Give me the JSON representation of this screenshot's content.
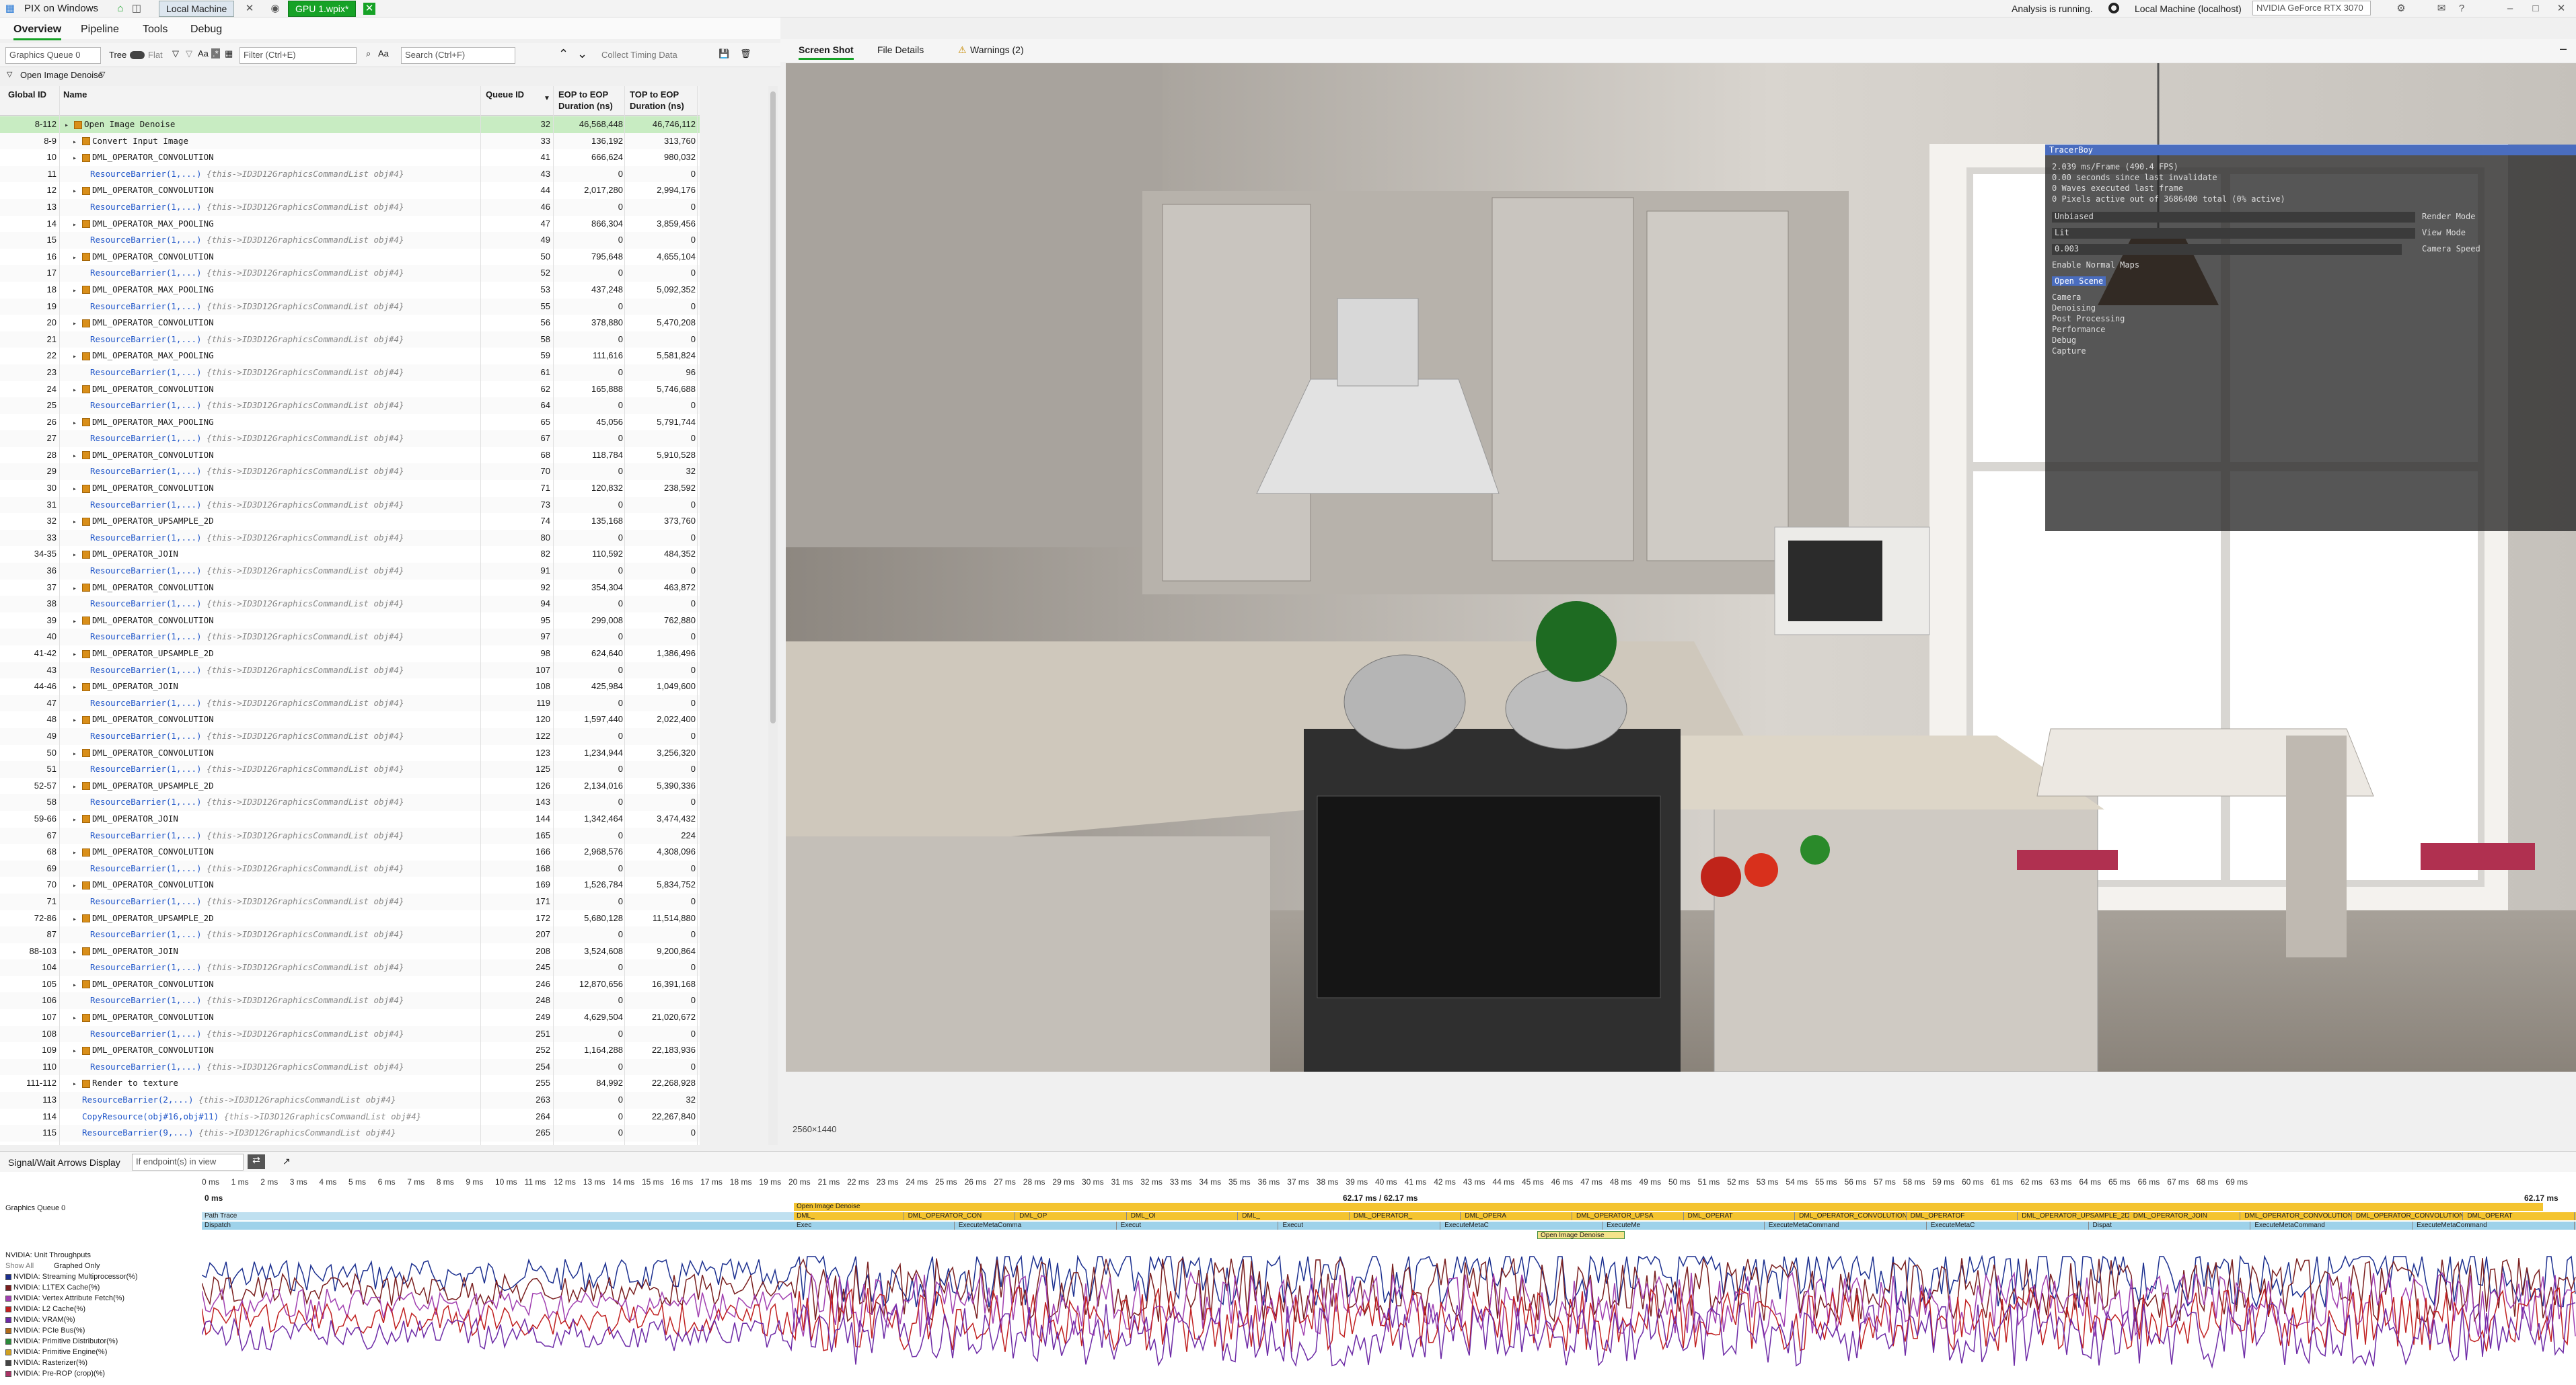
{
  "titlebar": {
    "app_name": "PIX on Windows",
    "tabs": [
      "Local Machine",
      "GPU 1.wpix*"
    ],
    "analysis_status": "Analysis is running.",
    "machine": "Local Machine (localhost)",
    "gpu": "NVIDIA GeForce RTX 3070"
  },
  "menu": {
    "items": [
      "Overview",
      "Pipeline",
      "Tools",
      "Debug"
    ],
    "active": "Overview"
  },
  "left_toolbar": {
    "queue": "Graphics Queue 0",
    "tree_label": "Tree",
    "flat_label": "Flat",
    "filter_placeholder": "Filter (Ctrl+E)",
    "search_placeholder": "Search (Ctrl+F)",
    "collect_timing": "Collect Timing Data",
    "breadcrumb": "Open Image Denoise"
  },
  "table": {
    "headers": [
      "Global ID",
      "Name",
      "Queue ID",
      "EOP to EOP\nDuration (ns)",
      "TOP to EOP\nDuration (ns)"
    ],
    "rows": [
      {
        "gid": "8-112",
        "name": "Open Image Denoise",
        "q": "32",
        "eop": "46,568,448",
        "top": "46,746,112",
        "kind": "group",
        "sel": true,
        "indent": 0
      },
      {
        "gid": "8-9",
        "name": "Convert Input Image",
        "q": "33",
        "eop": "136,192",
        "top": "313,760",
        "kind": "group",
        "indent": 1
      },
      {
        "gid": "10",
        "name": "DML_OPERATOR_CONVOLUTION",
        "q": "41",
        "eop": "666,624",
        "top": "980,032",
        "kind": "group",
        "indent": 1
      },
      {
        "gid": "11",
        "name": "ResourceBarrier(1,...)",
        "q": "43",
        "eop": "0",
        "top": "0",
        "kind": "call",
        "indent": 2
      },
      {
        "gid": "12",
        "name": "DML_OPERATOR_CONVOLUTION",
        "q": "44",
        "eop": "2,017,280",
        "top": "2,994,176",
        "kind": "group",
        "indent": 1
      },
      {
        "gid": "13",
        "name": "ResourceBarrier(1,...)",
        "q": "46",
        "eop": "0",
        "top": "0",
        "kind": "call",
        "indent": 2
      },
      {
        "gid": "14",
        "name": "DML_OPERATOR_MAX_POOLING",
        "q": "47",
        "eop": "866,304",
        "top": "3,859,456",
        "kind": "group",
        "indent": 1
      },
      {
        "gid": "15",
        "name": "ResourceBarrier(1,...)",
        "q": "49",
        "eop": "0",
        "top": "0",
        "kind": "call",
        "indent": 2
      },
      {
        "gid": "16",
        "name": "DML_OPERATOR_CONVOLUTION",
        "q": "50",
        "eop": "795,648",
        "top": "4,655,104",
        "kind": "group",
        "indent": 1
      },
      {
        "gid": "17",
        "name": "ResourceBarrier(1,...)",
        "q": "52",
        "eop": "0",
        "top": "0",
        "kind": "call",
        "indent": 2
      },
      {
        "gid": "18",
        "name": "DML_OPERATOR_MAX_POOLING",
        "q": "53",
        "eop": "437,248",
        "top": "5,092,352",
        "kind": "group",
        "indent": 1
      },
      {
        "gid": "19",
        "name": "ResourceBarrier(1,...)",
        "q": "55",
        "eop": "0",
        "top": "0",
        "kind": "call",
        "indent": 2
      },
      {
        "gid": "20",
        "name": "DML_OPERATOR_CONVOLUTION",
        "q": "56",
        "eop": "378,880",
        "top": "5,470,208",
        "kind": "group",
        "indent": 1
      },
      {
        "gid": "21",
        "name": "ResourceBarrier(1,...)",
        "q": "58",
        "eop": "0",
        "top": "0",
        "kind": "call",
        "indent": 2
      },
      {
        "gid": "22",
        "name": "DML_OPERATOR_MAX_POOLING",
        "q": "59",
        "eop": "111,616",
        "top": "5,581,824",
        "kind": "group",
        "indent": 1
      },
      {
        "gid": "23",
        "name": "ResourceBarrier(1,...)",
        "q": "61",
        "eop": "0",
        "top": "96",
        "kind": "call",
        "indent": 2
      },
      {
        "gid": "24",
        "name": "DML_OPERATOR_CONVOLUTION",
        "q": "62",
        "eop": "165,888",
        "top": "5,746,688",
        "kind": "group",
        "indent": 1
      },
      {
        "gid": "25",
        "name": "ResourceBarrier(1,...)",
        "q": "64",
        "eop": "0",
        "top": "0",
        "kind": "call",
        "indent": 2
      },
      {
        "gid": "26",
        "name": "DML_OPERATOR_MAX_POOLING",
        "q": "65",
        "eop": "45,056",
        "top": "5,791,744",
        "kind": "group",
        "indent": 1
      },
      {
        "gid": "27",
        "name": "ResourceBarrier(1,...)",
        "q": "67",
        "eop": "0",
        "top": "0",
        "kind": "call",
        "indent": 2
      },
      {
        "gid": "28",
        "name": "DML_OPERATOR_CONVOLUTION",
        "q": "68",
        "eop": "118,784",
        "top": "5,910,528",
        "kind": "group",
        "indent": 1
      },
      {
        "gid": "29",
        "name": "ResourceBarrier(1,...)",
        "q": "70",
        "eop": "0",
        "top": "32",
        "kind": "call",
        "indent": 2
      },
      {
        "gid": "30",
        "name": "DML_OPERATOR_CONVOLUTION",
        "q": "71",
        "eop": "120,832",
        "top": "238,592",
        "kind": "group",
        "indent": 1
      },
      {
        "gid": "31",
        "name": "ResourceBarrier(1,...)",
        "q": "73",
        "eop": "0",
        "top": "0",
        "kind": "call",
        "indent": 2
      },
      {
        "gid": "32",
        "name": "DML_OPERATOR_UPSAMPLE_2D",
        "q": "74",
        "eop": "135,168",
        "top": "373,760",
        "kind": "group",
        "indent": 1
      },
      {
        "gid": "33",
        "name": "ResourceBarrier(1,...)",
        "q": "80",
        "eop": "0",
        "top": "0",
        "kind": "call",
        "indent": 2
      },
      {
        "gid": "34-35",
        "name": "DML_OPERATOR_JOIN",
        "q": "82",
        "eop": "110,592",
        "top": "484,352",
        "kind": "group",
        "indent": 1
      },
      {
        "gid": "36",
        "name": "ResourceBarrier(1,...)",
        "q": "91",
        "eop": "0",
        "top": "0",
        "kind": "call",
        "indent": 2
      },
      {
        "gid": "37",
        "name": "DML_OPERATOR_CONVOLUTION",
        "q": "92",
        "eop": "354,304",
        "top": "463,872",
        "kind": "group",
        "indent": 1
      },
      {
        "gid": "38",
        "name": "ResourceBarrier(1,...)",
        "q": "94",
        "eop": "0",
        "top": "0",
        "kind": "call",
        "indent": 2
      },
      {
        "gid": "39",
        "name": "DML_OPERATOR_CONVOLUTION",
        "q": "95",
        "eop": "299,008",
        "top": "762,880",
        "kind": "group",
        "indent": 1
      },
      {
        "gid": "40",
        "name": "ResourceBarrier(1,...)",
        "q": "97",
        "eop": "0",
        "top": "0",
        "kind": "call",
        "indent": 2
      },
      {
        "gid": "41-42",
        "name": "DML_OPERATOR_UPSAMPLE_2D",
        "q": "98",
        "eop": "624,640",
        "top": "1,386,496",
        "kind": "group",
        "indent": 1
      },
      {
        "gid": "43",
        "name": "ResourceBarrier(1,...)",
        "q": "107",
        "eop": "0",
        "top": "0",
        "kind": "call",
        "indent": 2
      },
      {
        "gid": "44-46",
        "name": "DML_OPERATOR_JOIN",
        "q": "108",
        "eop": "425,984",
        "top": "1,049,600",
        "kind": "group",
        "indent": 1
      },
      {
        "gid": "47",
        "name": "ResourceBarrier(1,...)",
        "q": "119",
        "eop": "0",
        "top": "0",
        "kind": "call",
        "indent": 2
      },
      {
        "gid": "48",
        "name": "DML_OPERATOR_CONVOLUTION",
        "q": "120",
        "eop": "1,597,440",
        "top": "2,022,400",
        "kind": "group",
        "indent": 1
      },
      {
        "gid": "49",
        "name": "ResourceBarrier(1,...)",
        "q": "122",
        "eop": "0",
        "top": "0",
        "kind": "call",
        "indent": 2
      },
      {
        "gid": "50",
        "name": "DML_OPERATOR_CONVOLUTION",
        "q": "123",
        "eop": "1,234,944",
        "top": "3,256,320",
        "kind": "group",
        "indent": 1
      },
      {
        "gid": "51",
        "name": "ResourceBarrier(1,...)",
        "q": "125",
        "eop": "0",
        "top": "0",
        "kind": "call",
        "indent": 2
      },
      {
        "gid": "52-57",
        "name": "DML_OPERATOR_UPSAMPLE_2D",
        "q": "126",
        "eop": "2,134,016",
        "top": "5,390,336",
        "kind": "group",
        "indent": 1
      },
      {
        "gid": "58",
        "name": "ResourceBarrier(1,...)",
        "q": "143",
        "eop": "0",
        "top": "0",
        "kind": "call",
        "indent": 2
      },
      {
        "gid": "59-66",
        "name": "DML_OPERATOR_JOIN",
        "q": "144",
        "eop": "1,342,464",
        "top": "3,474,432",
        "kind": "group",
        "indent": 1
      },
      {
        "gid": "67",
        "name": "ResourceBarrier(1,...)",
        "q": "165",
        "eop": "0",
        "top": "224",
        "kind": "call",
        "indent": 2
      },
      {
        "gid": "68",
        "name": "DML_OPERATOR_CONVOLUTION",
        "q": "166",
        "eop": "2,968,576",
        "top": "4,308,096",
        "kind": "group",
        "indent": 1
      },
      {
        "gid": "69",
        "name": "ResourceBarrier(1,...)",
        "q": "168",
        "eop": "0",
        "top": "0",
        "kind": "call",
        "indent": 2
      },
      {
        "gid": "70",
        "name": "DML_OPERATOR_CONVOLUTION",
        "q": "169",
        "eop": "1,526,784",
        "top": "5,834,752",
        "kind": "group",
        "indent": 1
      },
      {
        "gid": "71",
        "name": "ResourceBarrier(1,...)",
        "q": "171",
        "eop": "0",
        "top": "0",
        "kind": "call",
        "indent": 2
      },
      {
        "gid": "72-86",
        "name": "DML_OPERATOR_UPSAMPLE_2D",
        "q": "172",
        "eop": "5,680,128",
        "top": "11,514,880",
        "kind": "group",
        "indent": 1
      },
      {
        "gid": "87",
        "name": "ResourceBarrier(1,...)",
        "q": "207",
        "eop": "0",
        "top": "0",
        "kind": "call",
        "indent": 2
      },
      {
        "gid": "88-103",
        "name": "DML_OPERATOR_JOIN",
        "q": "208",
        "eop": "3,524,608",
        "top": "9,200,864",
        "kind": "group",
        "indent": 1
      },
      {
        "gid": "104",
        "name": "ResourceBarrier(1,...)",
        "q": "245",
        "eop": "0",
        "top": "0",
        "kind": "call",
        "indent": 2
      },
      {
        "gid": "105",
        "name": "DML_OPERATOR_CONVOLUTION",
        "q": "246",
        "eop": "12,870,656",
        "top": "16,391,168",
        "kind": "group",
        "indent": 1
      },
      {
        "gid": "106",
        "name": "ResourceBarrier(1,...)",
        "q": "248",
        "eop": "0",
        "top": "0",
        "kind": "call",
        "indent": 2
      },
      {
        "gid": "107",
        "name": "DML_OPERATOR_CONVOLUTION",
        "q": "249",
        "eop": "4,629,504",
        "top": "21,020,672",
        "kind": "group",
        "indent": 1
      },
      {
        "gid": "108",
        "name": "ResourceBarrier(1,...)",
        "q": "251",
        "eop": "0",
        "top": "0",
        "kind": "call",
        "indent": 2
      },
      {
        "gid": "109",
        "name": "DML_OPERATOR_CONVOLUTION",
        "q": "252",
        "eop": "1,164,288",
        "top": "22,183,936",
        "kind": "group",
        "indent": 1
      },
      {
        "gid": "110",
        "name": "ResourceBarrier(1,...)",
        "q": "254",
        "eop": "0",
        "top": "0",
        "kind": "call",
        "indent": 2
      },
      {
        "gid": "111-112",
        "name": "Render to texture",
        "q": "255",
        "eop": "84,992",
        "top": "22,268,928",
        "kind": "group",
        "indent": 1
      },
      {
        "gid": "113",
        "name": "ResourceBarrier(2,...)",
        "q": "263",
        "eop": "0",
        "top": "32",
        "kind": "call",
        "indent": 1
      },
      {
        "gid": "114",
        "name": "CopyResource(obj#16,obj#11)",
        "q": "264",
        "eop": "0",
        "top": "22,267,840",
        "kind": "call",
        "indent": 1
      },
      {
        "gid": "115",
        "name": "ResourceBarrier(9,...)",
        "q": "265",
        "eop": "0",
        "top": "0",
        "kind": "call",
        "indent": 1
      }
    ],
    "call_suffix": "{this->ID3D12GraphicsCommandList obj#4}"
  },
  "right_tabs": {
    "items": [
      "Screen Shot",
      "File Details",
      "Warnings (2)"
    ],
    "active": "Screen Shot"
  },
  "screenshot": {
    "resolution": "2560×1440"
  },
  "tracer": {
    "title": "TracerBoy",
    "lines": [
      "2.039 ms/Frame (490.4 FPS)",
      "0.00 seconds since last invalidate",
      "0 Waves executed last frame",
      "0 Pixels active out of 3686400 total (0% active)"
    ],
    "render_mode": {
      "value": "Unbiased",
      "label": "Render Mode"
    },
    "view_mode": {
      "value": "Lit",
      "label": "View Mode"
    },
    "camera_speed": {
      "value": "0.003",
      "label": "Camera Speed"
    },
    "normal_maps": "Enable Normal Maps",
    "open_scene": "Open Scene",
    "sections": [
      "Camera",
      "Denoising",
      "Post Processing",
      "Performance",
      "Debug",
      "Capture"
    ]
  },
  "timeline": {
    "signal_label": "Signal/Wait Arrows Display",
    "signal_value": "If endpoint(s) in view",
    "ticks": [
      "0 ms",
      "1 ms",
      "2 ms",
      "3 ms",
      "4 ms",
      "5 ms",
      "6 ms",
      "7 ms",
      "8 ms",
      "9 ms",
      "10 ms",
      "11 ms",
      "12 ms",
      "13 ms",
      "14 ms",
      "15 ms",
      "16 ms",
      "17 ms",
      "18 ms",
      "19 ms",
      "20 ms",
      "21 ms",
      "22 ms",
      "23 ms",
      "24 ms",
      "25 ms",
      "26 ms",
      "27 ms",
      "28 ms",
      "29 ms",
      "30 ms",
      "31 ms",
      "32 ms",
      "33 ms",
      "34 ms",
      "35 ms",
      "36 ms",
      "37 ms",
      "38 ms",
      "39 ms",
      "40 ms",
      "41 ms",
      "42 ms",
      "43 ms",
      "44 ms",
      "45 ms",
      "46 ms",
      "47 ms",
      "48 ms",
      "49 ms",
      "50 ms",
      "51 ms",
      "52 ms",
      "53 ms",
      "54 ms",
      "55 ms",
      "56 ms",
      "57 ms",
      "58 ms",
      "59 ms",
      "60 ms",
      "61 ms",
      "62 ms",
      "63 ms",
      "64 ms",
      "65 ms",
      "66 ms",
      "67 ms",
      "68 ms",
      "69 ms"
    ],
    "range": "62.17 ms / 62.17 ms",
    "range_end": "62.17 ms",
    "start": "0 ms",
    "queue_label": "Graphics Queue 0",
    "lanes": {
      "path_trace": "Path Trace",
      "dispatch": "Dispatch",
      "denoise": "Open Image Denoise"
    },
    "ops": [
      "DML_",
      "DML_OPERATOR_CON",
      "DML_OP",
      "DML_OI",
      "DML_",
      "DML_OPERATOR_",
      "DML_OPERA",
      "DML_OPERATOR_UPSA",
      "DML_OPERAT",
      "DML_OPERATOR_CONVOLUTION",
      "DML_OPERATOF",
      "DML_OPERATOR_UPSAMPLE_2D",
      "DML_OPERATOR_JOIN",
      "DML_OPERATOR_CONVOLUTION",
      "DML_OPERATOR_CONVOLUTION",
      "DML_OPERAT"
    ],
    "execs": [
      "Exec",
      "ExecuteMetaComma",
      "Execut",
      "Execut",
      "ExecuteMetaC",
      "ExecuteMe",
      "ExecuteMetaCommand",
      "ExecuteMetaC",
      "Dispat",
      "ExecuteMetaCommand",
      "ExecuteMetaCommand"
    ],
    "denoise_marker": "Open Image Denoise",
    "counters_title": "NVIDIA: Unit Throughputs",
    "show_all": "Show All",
    "graphed_only": "Graphed Only",
    "counters": [
      {
        "name": "NVIDIA: Streaming Multiprocessor(%)",
        "color": "#1b2f8f"
      },
      {
        "name": "NVIDIA: L1TEX Cache(%)",
        "color": "#7a1f1f"
      },
      {
        "name": "NVIDIA: Vertex Attribute Fetch(%)",
        "color": "#a03fb0"
      },
      {
        "name": "NVIDIA: L2 Cache(%)",
        "color": "#c02020"
      },
      {
        "name": "NVIDIA: VRAM(%)",
        "color": "#6d2aa6"
      },
      {
        "name": "NVIDIA: PCIe Bus(%)",
        "color": "#b06a1a"
      },
      {
        "name": "NVIDIA: Primitive Distributor(%)",
        "color": "#2a8a3a"
      },
      {
        "name": "NVIDIA: Primitive Engine(%)",
        "color": "#d0a020"
      },
      {
        "name": "NVIDIA: Rasterizer(%)",
        "color": "#444444"
      },
      {
        "name": "NVIDIA: Pre-ROP (crop)(%)",
        "color": "#aa3366"
      }
    ]
  }
}
